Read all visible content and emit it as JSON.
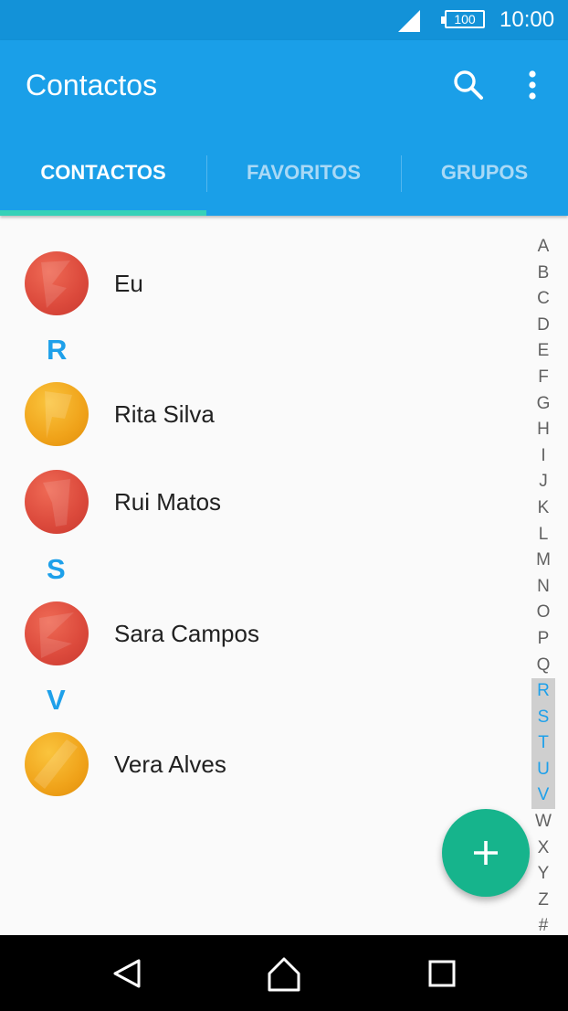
{
  "status_bar": {
    "battery": "100",
    "time": "10:00"
  },
  "app_bar": {
    "title": "Contactos"
  },
  "tabs": [
    {
      "label": "CONTACTOS",
      "active": true
    },
    {
      "label": "FAVORITOS",
      "active": false
    },
    {
      "label": "GRUPOS",
      "active": false
    }
  ],
  "contacts": {
    "me": "Eu",
    "sections": [
      {
        "letter": "R",
        "items": [
          "Rita Silva",
          "Rui Matos"
        ]
      },
      {
        "letter": "S",
        "items": [
          "Sara Campos"
        ]
      },
      {
        "letter": "V",
        "items": [
          "Vera Alves"
        ]
      }
    ]
  },
  "alphabet_index": [
    "A",
    "B",
    "C",
    "D",
    "E",
    "F",
    "G",
    "H",
    "I",
    "J",
    "K",
    "L",
    "M",
    "N",
    "O",
    "P",
    "Q",
    "R",
    "S",
    "T",
    "U",
    "V",
    "W",
    "X",
    "Y",
    "Z",
    "#"
  ],
  "highlighted_letters": [
    "R",
    "S",
    "T",
    "U",
    "V"
  ],
  "icons": {
    "search": "search-icon",
    "more": "more-vert-icon",
    "fab": "plus-icon",
    "nav": [
      "back-icon",
      "home-icon",
      "recents-icon"
    ]
  },
  "colors": {
    "status_bar": "#1392d8",
    "app_bar": "#1a9fe8",
    "tab_indicator": "#36d1b8",
    "section_letter": "#1ea0ea",
    "fab": "#16b48c"
  }
}
